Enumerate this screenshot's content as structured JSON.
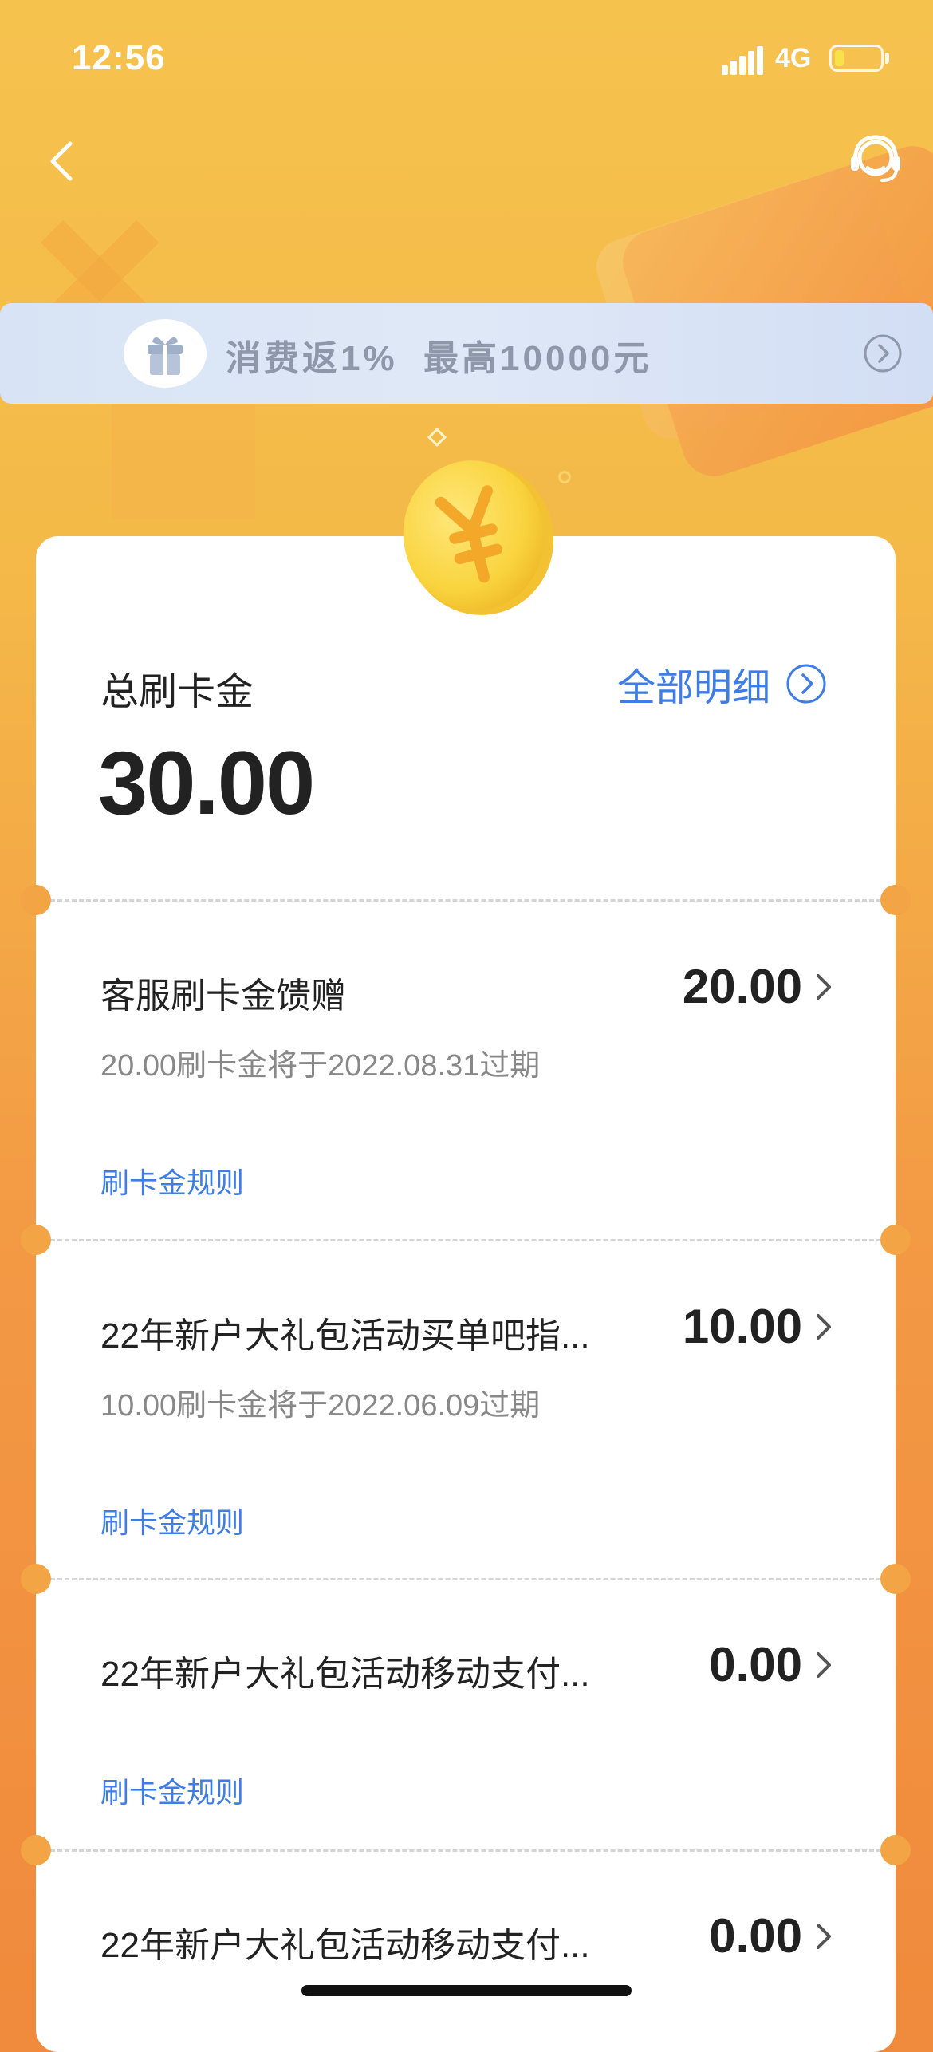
{
  "status_bar": {
    "time": "12:56",
    "network": "4G",
    "battery_level": 0.2
  },
  "banner": {
    "text": "消费返1%  最高10000元"
  },
  "summary": {
    "label": "总刷卡金",
    "value": "30.00",
    "detail_link": "全部明细"
  },
  "items": [
    {
      "title": "客服刷卡金馈赠",
      "amount": "20.00",
      "expiry": "20.00刷卡金将于2022.08.31过期",
      "rule": "刷卡金规则"
    },
    {
      "title": "22年新户大礼包活动买单吧指...",
      "amount": "10.00",
      "expiry": "10.00刷卡金将于2022.06.09过期",
      "rule": "刷卡金规则"
    },
    {
      "title": "22年新户大礼包活动移动支付...",
      "amount": "0.00",
      "expiry": "",
      "rule": "刷卡金规则"
    },
    {
      "title": "22年新户大礼包活动移动支付...",
      "amount": "0.00",
      "expiry": "",
      "rule": ""
    }
  ],
  "colors": {
    "accent_blue": "#3e7ce6",
    "background_orange": "#f08a3c",
    "banner_bg": "#dfe8f7"
  },
  "icons": {
    "back": "chevron-left-icon",
    "service": "customer-service-icon",
    "gift": "gift-icon",
    "coin": "yuan-coin-icon",
    "arrow": "chevron-right-icon"
  }
}
